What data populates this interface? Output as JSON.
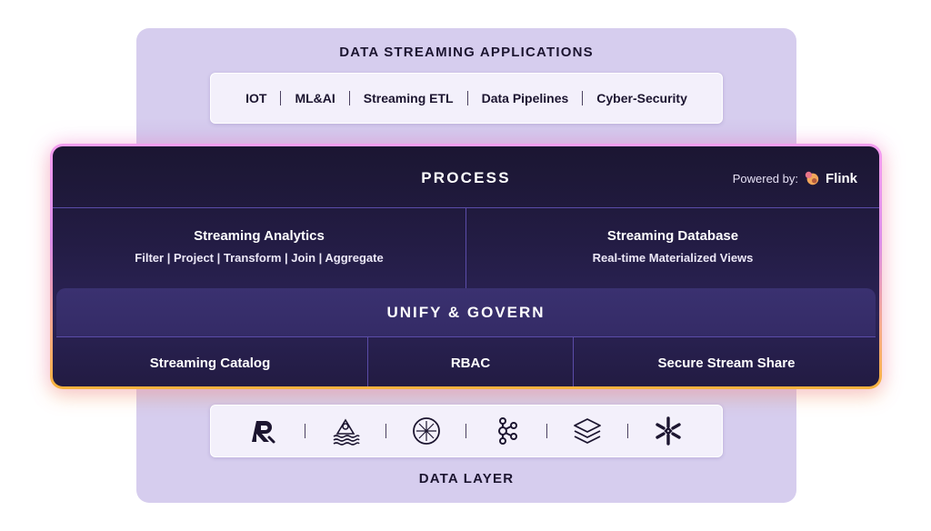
{
  "applications": {
    "title": "DATA STREAMING APPLICATIONS",
    "items": [
      "IOT",
      "ML&AI",
      "Streaming ETL",
      "Data Pipelines",
      "Cyber-Security"
    ]
  },
  "process": {
    "title": "PROCESS",
    "powered_by_label": "Powered by:",
    "powered_by_name": "Flink",
    "cells": [
      {
        "title": "Streaming Analytics",
        "subtitle": "Filter | Project | Transform | Join | Aggregate"
      },
      {
        "title": "Streaming Database",
        "subtitle": "Real-time Materialized Views"
      }
    ]
  },
  "unify": {
    "title": "UNIFY & GOVERN",
    "cells": [
      "Streaming Catalog",
      "RBAC",
      "Secure Stream Share"
    ]
  },
  "data_layer": {
    "title": "DATA LAYER",
    "logos": [
      "redpanda-logo-icon",
      "kafka-on-waves-logo-icon",
      "starburst-logo-icon",
      "kafka-nodes-logo-icon",
      "layers-stack-logo-icon",
      "snowflake-logo-icon"
    ]
  },
  "colors": {
    "outer_bg": "#d6cdee",
    "dark_bg": "#231c44",
    "border_top": "#f59ef0",
    "border_bottom": "#f7b23c",
    "text_dark": "#1c1530"
  }
}
